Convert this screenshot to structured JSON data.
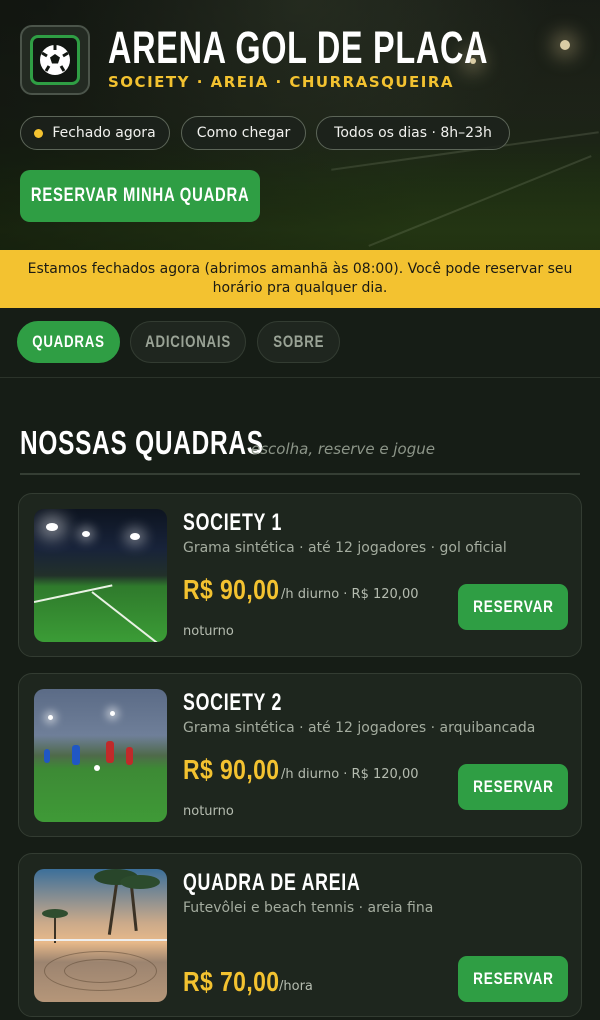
{
  "header": {
    "title": "ARENA GOL DE PLACA",
    "subtitle": "SOCIETY · AREIA · CHURRASQUEIRA",
    "logo_icon": "soccer-ball-icon",
    "pills": {
      "status": "Fechado agora",
      "directions": "Como chegar",
      "hours": "Todos os dias · 8h–23h"
    },
    "cta_label": "RESERVAR MINHA QUADRA"
  },
  "banner": {
    "text": "Estamos fechados agora (abrimos amanhã às 08:00). Você pode reservar seu horário pra qualquer dia."
  },
  "tabs": [
    {
      "label": "QUADRAS",
      "active": true
    },
    {
      "label": "ADICIONAIS",
      "active": false
    },
    {
      "label": "SOBRE",
      "active": false
    }
  ],
  "section": {
    "title": "NOSSAS QUADRAS",
    "subtitle": "escolha, reserve e jogue"
  },
  "courts": [
    {
      "name": "SOCIETY 1",
      "description": "Grama sintética · até 12 jogadores · gol oficial",
      "price": "R$ 90,00",
      "unit_line1": "/h diurno · R$ 120,00",
      "unit_line2": "noturno",
      "button": "RESERVAR"
    },
    {
      "name": "SOCIETY 2",
      "description": "Grama sintética · até 12 jogadores · arquibancada",
      "price": "R$ 90,00",
      "unit_line1": "/h diurno · R$ 120,00",
      "unit_line2": "noturno",
      "button": "RESERVAR"
    },
    {
      "name": "QUADRA DE AREIA",
      "description": "Futevôlei e beach tennis · areia fina",
      "price": "R$ 70,00",
      "unit_line1": "/hora",
      "unit_line2": "",
      "button": "RESERVAR"
    }
  ],
  "colors": {
    "accent_green": "#2f9e44",
    "accent_yellow": "#f3c230",
    "background": "#161d16"
  }
}
